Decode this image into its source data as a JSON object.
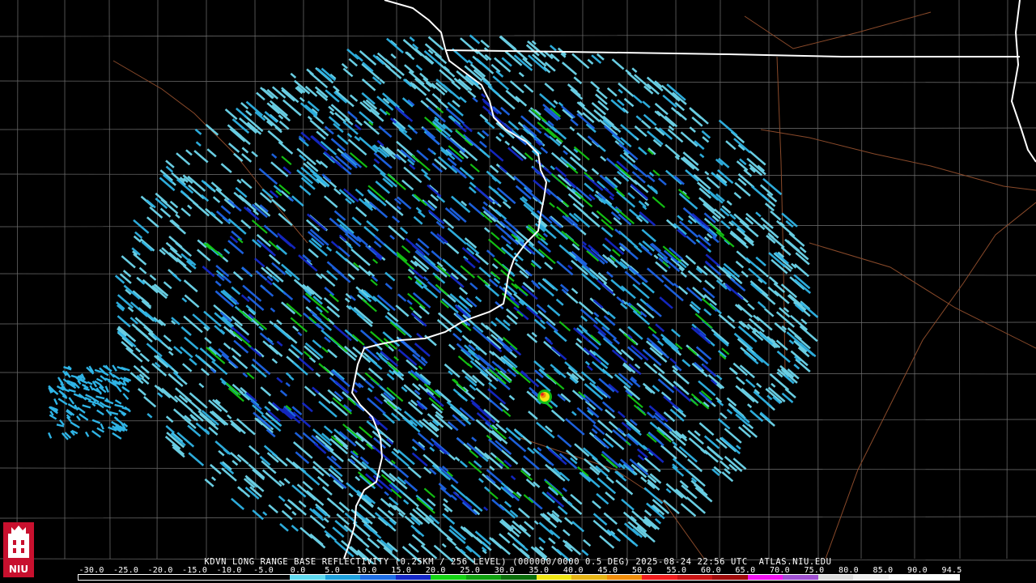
{
  "product": {
    "title": "KDVN LONG RANGE BASE REFLECTIVITY (0.25KM / 256 LEVEL) (000000/0000 0.5 DEG) 2025-08-24 22:56 UTC  ATLAS.NIU.EDU"
  },
  "logo": {
    "text": "NIU",
    "primary_color": "#c8102e"
  },
  "color_scale": {
    "labels": [
      "-30.0",
      "-25.0",
      "-20.0",
      "-15.0",
      "-10.0",
      "-5.0",
      "0.0",
      "5.0",
      "10.0",
      "15.0",
      "20.0",
      "25.0",
      "30.0",
      "35.0",
      "40.0",
      "45.0",
      "50.0",
      "55.0",
      "60.0",
      "65.0",
      "70.0",
      "75.0",
      "80.0",
      "85.0",
      "90.0",
      "94.5"
    ],
    "colors": [
      "#000000",
      "#000000",
      "#000000",
      "#000000",
      "#000000",
      "#000000",
      "#5fd9ef",
      "#1ea0dc",
      "#1e6ee6",
      "#1428c8",
      "#14d214",
      "#0fa00f",
      "#0a6e0a",
      "#f0e614",
      "#e6b414",
      "#f08c0a",
      "#f01e1e",
      "#c81414",
      "#a00a0a",
      "#f014f0",
      "#a050d2",
      "#dcdcdc",
      "#f0f0f0",
      "#ffffff",
      "#ffffff"
    ]
  },
  "reflectivity_colors": {
    "light_cyan": "#6fd8ee",
    "cyan": "#2fb4e6",
    "blue": "#1e64e6",
    "dark_blue": "#1428c8",
    "green": "#14c814",
    "yellow": "#f0e614",
    "orange": "#f08c0a",
    "red": "#e61e1e"
  },
  "map_colors": {
    "state_border": "#ffffff",
    "county_border": "#9a9a9a",
    "highway": "#8a4a2a",
    "background": "#000000"
  }
}
